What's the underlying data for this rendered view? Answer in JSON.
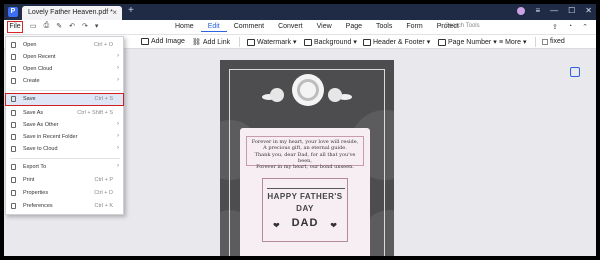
{
  "titlebar": {
    "doc_tab_title": "Lovely Father Heaven.pdf *",
    "tab_close": "×",
    "new_tab": "+"
  },
  "menubar": {
    "file_label": "File",
    "items": [
      "Home",
      "Edit",
      "Comment",
      "Convert",
      "View",
      "Page",
      "Tools",
      "Form",
      "Protect"
    ],
    "active_item": "Edit",
    "search_placeholder": "Search Tools"
  },
  "toolbar": {
    "add_image": "Add Image",
    "add_link": "Add Link",
    "watermark": "Watermark",
    "background": "Background",
    "header_footer": "Header & Footer",
    "page_number": "Page Number",
    "more": "More",
    "fixed": "fixed"
  },
  "file_menu": {
    "items": [
      {
        "label": "Open",
        "shortcut": "Ctrl + O",
        "submenu": false
      },
      {
        "label": "Open Recent",
        "shortcut": "",
        "submenu": true
      },
      {
        "label": "Open Cloud",
        "shortcut": "",
        "submenu": true
      },
      {
        "label": "Create",
        "shortcut": "",
        "submenu": true
      },
      {
        "label": "Save",
        "shortcut": "Ctrl + S",
        "submenu": false
      },
      {
        "label": "Save As",
        "shortcut": "Ctrl + Shift + S",
        "submenu": false
      },
      {
        "label": "Save As Other",
        "shortcut": "",
        "submenu": true
      },
      {
        "label": "Save in Recent Folder",
        "shortcut": "",
        "submenu": true
      },
      {
        "label": "Save to Cloud",
        "shortcut": "",
        "submenu": true
      },
      {
        "label": "Export To",
        "shortcut": "",
        "submenu": true
      },
      {
        "label": "Print",
        "shortcut": "Ctrl + P",
        "submenu": false
      },
      {
        "label": "Properties",
        "shortcut": "Ctrl + D",
        "submenu": false
      },
      {
        "label": "Preferences",
        "shortcut": "Ctrl + K",
        "submenu": false
      }
    ],
    "highlighted": "Save"
  },
  "document": {
    "poem_lines": [
      "Forever in my heart, your love will reside,",
      "A precious gift, an eternal guide.",
      "Thank you, dear Dad, for all that you've been,",
      "Forever in my heart, our bond unseen."
    ],
    "greeting_line1": "HAPPY FATHER'S",
    "greeting_line2": "DAY",
    "greeting_line3": "DAD",
    "heart_glyph": "❤"
  },
  "colors": {
    "accent": "#2b63e0",
    "highlight_outline": "#cf2020",
    "titlebar": "#1f2a44"
  }
}
